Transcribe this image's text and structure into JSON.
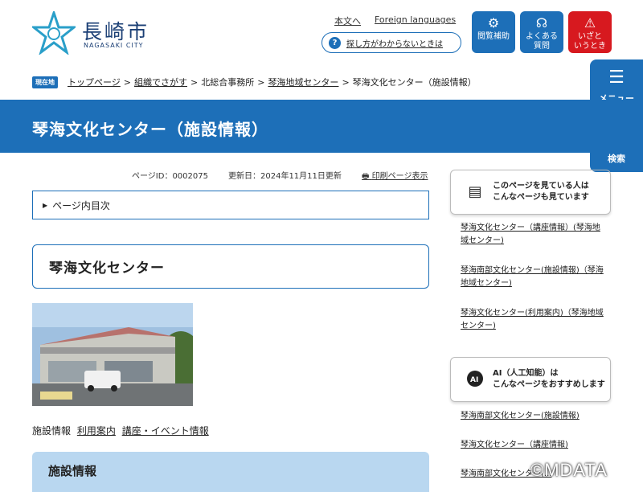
{
  "header": {
    "logo_text": "長崎市",
    "logo_sub": "NAGASAKI CITY",
    "skip_link": "本文へ",
    "foreign_link": "Foreign languages",
    "search_help": "探し方がわからないときは",
    "buttons": [
      {
        "label1": "閲覧補助",
        "label2": "",
        "icon": "gear-icon",
        "color": "#1d6fb8"
      },
      {
        "label1": "よくある",
        "label2": "質問",
        "icon": "headset-icon",
        "color": "#1d6fb8"
      },
      {
        "label1": "いざと",
        "label2": "いうとき",
        "icon": "alert-icon",
        "color": "#d7191f"
      }
    ]
  },
  "side": {
    "menu_label": "メニュー",
    "search_label": "検索"
  },
  "breadcrumb": {
    "badge": "現在地",
    "items": [
      "トップページ",
      "組織でさがす",
      "北総合事務所",
      "琴海地域センター",
      "琴海文化センター（施設情報）"
    ]
  },
  "page": {
    "title": "琴海文化センター（施設情報）",
    "page_id": "ページID：0002075",
    "updated": "更新日：2024年11月11日更新",
    "print": "印刷ページ表示",
    "toc": "ページ内目次",
    "heading": "琴海文化センター",
    "links_label": "施設情報",
    "link_usage": "利用案内",
    "link_events": "講座・イベント情報",
    "section": "施設情報"
  },
  "related": {
    "box_line1": "このページを見ている人は",
    "box_line2": "こんなページも見ています",
    "links": [
      "琴海文化センター（講座情報）(琴海地域センター)",
      "琴海南部文化センター(施設情報)（琴海地域センター)",
      "琴海文化センター(利用案内)（琴海地域センター)"
    ]
  },
  "ai": {
    "box_line1": "AI（人工知能）は",
    "box_line2": "こんなページをおすすめします",
    "links": [
      "琴海南部文化センター(施設情報)",
      "琴海文化センター（講座情報)",
      "琴海南部文化センター(..."
    ]
  },
  "watermark": "©MDATA",
  "colors": {
    "primary": "#1d6fb8",
    "emergency": "#d7191f",
    "section_bg": "#b9d7f0"
  }
}
